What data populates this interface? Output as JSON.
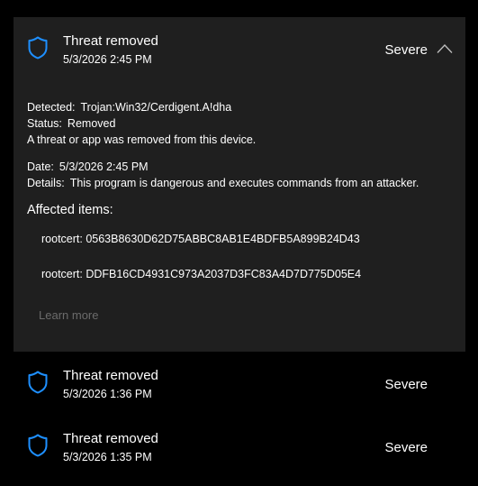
{
  "colors": {
    "accent": "#1e8fff",
    "panel": "#1f1f1f",
    "muted": "#6b6b6b"
  },
  "items": [
    {
      "title": "Threat removed",
      "date": "5/3/2026 2:45 PM",
      "severity": "Severe",
      "icon": "shield-icon",
      "expanded": true,
      "details": {
        "detected_label": "Detected:",
        "detected_value": "Trojan:Win32/Cerdigent.A!dha",
        "status_label": "Status:",
        "status_value": "Removed",
        "message": "A threat or app was removed from this device.",
        "date_label": "Date:",
        "date_value": "5/3/2026 2:45 PM",
        "details_label": "Details:",
        "details_value": "This program is dangerous and executes commands from an attacker.",
        "affected_title": "Affected items:",
        "affected": [
          "rootcert: 0563B8630D62D75ABBC8AB1E4BDFB5A899B24D43",
          "rootcert: DDFB16CD4931C973A2037D3FC83A4D7D775D05E4"
        ],
        "learn_more": "Learn more"
      }
    },
    {
      "title": "Threat removed",
      "date": "5/3/2026 1:36 PM",
      "severity": "Severe",
      "icon": "shield-icon",
      "expanded": false
    },
    {
      "title": "Threat removed",
      "date": "5/3/2026 1:35 PM",
      "severity": "Severe",
      "icon": "shield-icon",
      "expanded": false
    }
  ]
}
